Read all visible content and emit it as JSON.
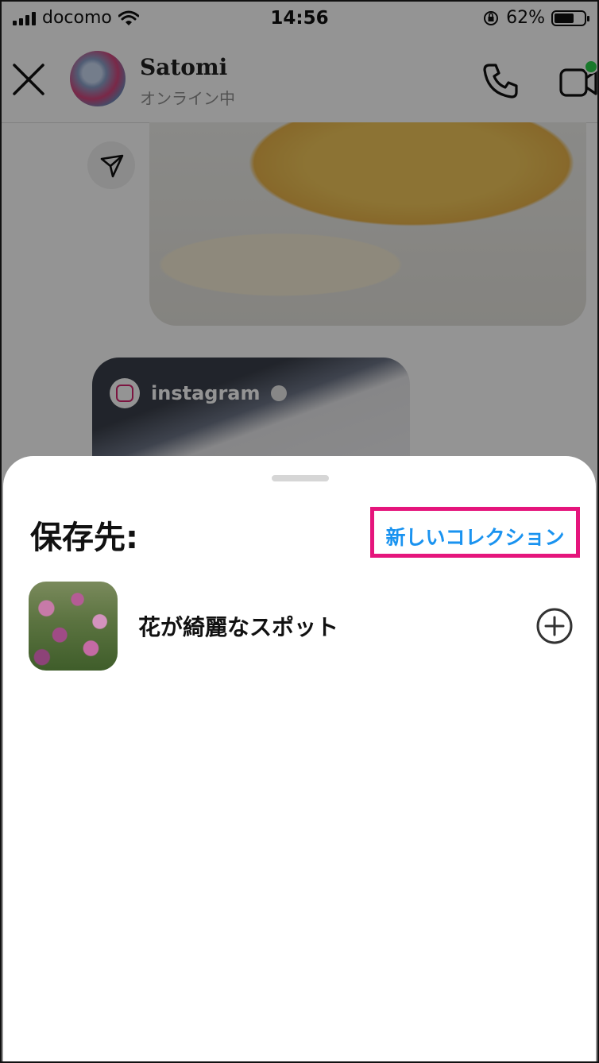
{
  "status_bar": {
    "carrier": "docomo",
    "time": "14:56",
    "battery": "62%"
  },
  "chat_header": {
    "contact_name": "Satomi",
    "contact_status": "オンライン中"
  },
  "shared_post": {
    "account_name": "instagram"
  },
  "save_sheet": {
    "title": "保存先:",
    "new_collection_label": "新しいコレクション",
    "collections": [
      {
        "name": "花が綺麗なスポット"
      }
    ]
  },
  "colors": {
    "accent_blue": "#1a93f0",
    "highlight_pink": "#e5157c"
  }
}
